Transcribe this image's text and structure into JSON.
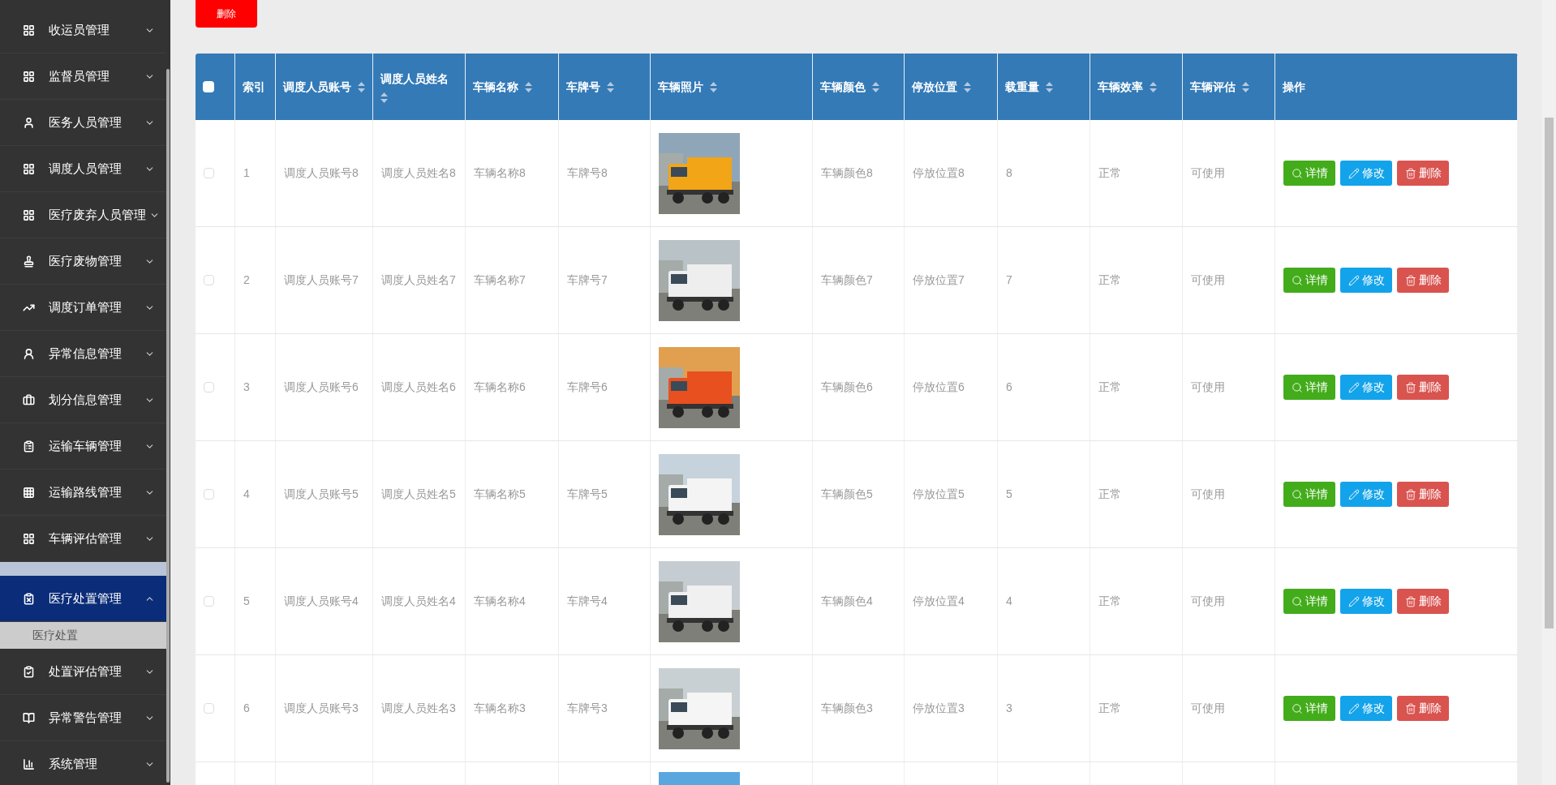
{
  "sidebar": {
    "items": [
      {
        "label": "收运员管理",
        "expanded": false,
        "selected": false
      },
      {
        "label": "监督员管理",
        "expanded": false,
        "selected": false
      },
      {
        "label": "医务人员管理",
        "expanded": false,
        "selected": false
      },
      {
        "label": "调度人员管理",
        "expanded": false,
        "selected": false
      },
      {
        "label": "医疗废弃人员管理",
        "expanded": false,
        "selected": false
      },
      {
        "label": "医疗废物管理",
        "expanded": false,
        "selected": false
      },
      {
        "label": "调度订单管理",
        "expanded": false,
        "selected": false
      },
      {
        "label": "异常信息管理",
        "expanded": false,
        "selected": false
      },
      {
        "label": "划分信息管理",
        "expanded": false,
        "selected": false
      },
      {
        "label": "运输车辆管理",
        "expanded": false,
        "selected": false
      },
      {
        "label": "运输路线管理",
        "expanded": false,
        "selected": false
      },
      {
        "label": "车辆评估管理",
        "expanded": false,
        "selected": false
      },
      {
        "label": "医疗处置管理",
        "expanded": true,
        "selected": true,
        "children": [
          {
            "label": "医疗处置",
            "selected": false
          }
        ]
      },
      {
        "label": "处置评估管理",
        "expanded": false,
        "selected": false
      },
      {
        "label": "异常警告管理",
        "expanded": false,
        "selected": false
      },
      {
        "label": "系统管理",
        "expanded": false,
        "selected": false
      }
    ]
  },
  "toolbar": {
    "delete_button": "删除"
  },
  "table": {
    "select_all": {
      "checked": false
    },
    "columns": [
      {
        "label": "索引",
        "sortable": false
      },
      {
        "label": "调度人员账号",
        "sortable": true
      },
      {
        "label": "调度人员姓名",
        "sortable": true
      },
      {
        "label": "车辆名称",
        "sortable": true
      },
      {
        "label": "车牌号",
        "sortable": true
      },
      {
        "label": "车辆照片",
        "sortable": true
      },
      {
        "label": "车辆颜色",
        "sortable": true
      },
      {
        "label": "停放位置",
        "sortable": true
      },
      {
        "label": "载重量",
        "sortable": true
      },
      {
        "label": "车辆效率",
        "sortable": true
      },
      {
        "label": "车辆评估",
        "sortable": true
      },
      {
        "label": "操作",
        "sortable": false
      }
    ],
    "rows": [
      {
        "checked": false,
        "cells": [
          "1",
          "调度人员账号8",
          "调度人员姓名8",
          "车辆名称8",
          "车牌号8",
          {
            "kind": "picture"
          },
          "车辆颜色8",
          "停放位置8",
          "8",
          "正常",
          "可使用"
        ],
        "actions": [
          "详情",
          "修改",
          "删除"
        ]
      },
      {
        "checked": false,
        "cells": [
          "2",
          "调度人员账号7",
          "调度人员姓名7",
          "车辆名称7",
          "车牌号7",
          {
            "kind": "picture"
          },
          "车辆颜色7",
          "停放位置7",
          "7",
          "正常",
          "可使用"
        ],
        "actions": [
          "详情",
          "修改",
          "删除"
        ]
      },
      {
        "checked": false,
        "cells": [
          "3",
          "调度人员账号6",
          "调度人员姓名6",
          "车辆名称6",
          "车牌号6",
          {
            "kind": "picture"
          },
          "车辆颜色6",
          "停放位置6",
          "6",
          "正常",
          "可使用"
        ],
        "actions": [
          "详情",
          "修改",
          "删除"
        ]
      },
      {
        "checked": false,
        "cells": [
          "4",
          "调度人员账号5",
          "调度人员姓名5",
          "车辆名称5",
          "车牌号5",
          {
            "kind": "picture"
          },
          "车辆颜色5",
          "停放位置5",
          "5",
          "正常",
          "可使用"
        ],
        "actions": [
          "详情",
          "修改",
          "删除"
        ]
      },
      {
        "checked": false,
        "cells": [
          "5",
          "调度人员账号4",
          "调度人员姓名4",
          "车辆名称4",
          "车牌号4",
          {
            "kind": "picture"
          },
          "车辆颜色4",
          "停放位置4",
          "4",
          "正常",
          "可使用"
        ],
        "actions": [
          "详情",
          "修改",
          "删除"
        ]
      },
      {
        "checked": false,
        "cells": [
          "6",
          "调度人员账号3",
          "调度人员姓名3",
          "车辆名称3",
          "车牌号3",
          {
            "kind": "picture"
          },
          "车辆颜色3",
          "停放位置3",
          "3",
          "正常",
          "可使用"
        ],
        "actions": [
          "详情",
          "修改",
          "删除"
        ]
      }
    ],
    "partial_row": {
      "cells": [
        {
          "kind": "picture"
        }
      ]
    }
  }
}
